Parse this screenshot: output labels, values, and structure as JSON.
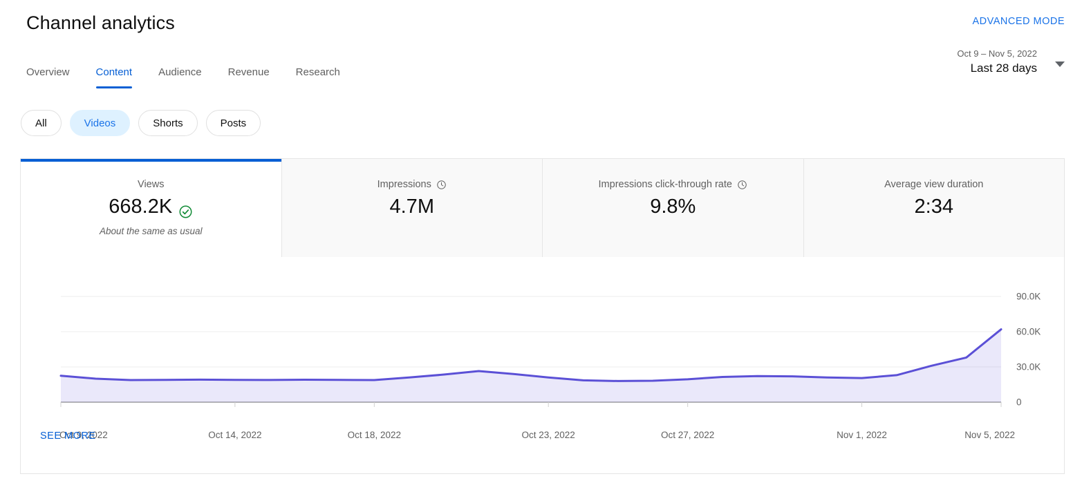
{
  "header": {
    "title": "Channel analytics",
    "advanced_mode_label": "ADVANCED MODE"
  },
  "tabs": [
    {
      "label": "Overview",
      "active": false
    },
    {
      "label": "Content",
      "active": true
    },
    {
      "label": "Audience",
      "active": false
    },
    {
      "label": "Revenue",
      "active": false
    },
    {
      "label": "Research",
      "active": false
    }
  ],
  "date_range": {
    "range_text": "Oct 9 – Nov 5, 2022",
    "preset_label": "Last 28 days",
    "caret_icon": "chevron-down-icon"
  },
  "chips": [
    {
      "label": "All",
      "selected": false
    },
    {
      "label": "Videos",
      "selected": true
    },
    {
      "label": "Shorts",
      "selected": false
    },
    {
      "label": "Posts",
      "selected": false
    }
  ],
  "metrics": [
    {
      "label": "Views",
      "value": "668.2K",
      "note": "About the same as usual",
      "selected": true,
      "has_clock_icon": false,
      "status_icon": "check-circle-icon"
    },
    {
      "label": "Impressions",
      "value": "4.7M",
      "note": "",
      "selected": false,
      "has_clock_icon": true,
      "status_icon": ""
    },
    {
      "label": "Impressions click-through rate",
      "value": "9.8%",
      "note": "",
      "selected": false,
      "has_clock_icon": true,
      "status_icon": ""
    },
    {
      "label": "Average view duration",
      "value": "2:34",
      "note": "",
      "selected": false,
      "has_clock_icon": false,
      "status_icon": ""
    }
  ],
  "footer": {
    "see_more_label": "SEE MORE"
  },
  "colors": {
    "accent_blue": "#065fd4",
    "link_blue": "#1a73e8",
    "line_purple": "#5b50d6",
    "area_fill": "#e9e7f8",
    "chip_selected_bg": "#def1ff",
    "status_green": "#0f8a34"
  },
  "chart_data": {
    "type": "area",
    "title": "",
    "xlabel": "",
    "ylabel": "",
    "ylim": [
      0,
      100000
    ],
    "yticks": [
      0,
      30000,
      60000,
      90000
    ],
    "ytick_labels": [
      "0",
      "30.0K",
      "60.0K",
      "90.0K"
    ],
    "grid": true,
    "legend": "none",
    "x": [
      "Oct 9, 2022",
      "Oct 10, 2022",
      "Oct 11, 2022",
      "Oct 12, 2022",
      "Oct 13, 2022",
      "Oct 14, 2022",
      "Oct 15, 2022",
      "Oct 16, 2022",
      "Oct 17, 2022",
      "Oct 18, 2022",
      "Oct 19, 2022",
      "Oct 20, 2022",
      "Oct 21, 2022",
      "Oct 22, 2022",
      "Oct 23, 2022",
      "Oct 24, 2022",
      "Oct 25, 2022",
      "Oct 26, 2022",
      "Oct 27, 2022",
      "Oct 28, 2022",
      "Oct 29, 2022",
      "Oct 30, 2022",
      "Oct 31, 2022",
      "Nov 1, 2022",
      "Nov 2, 2022",
      "Nov 3, 2022",
      "Nov 4, 2022",
      "Nov 5, 2022"
    ],
    "xtick_labels": [
      "Oct 9, 2022",
      "Oct 14, 2022",
      "Oct 18, 2022",
      "Oct 23, 2022",
      "Oct 27, 2022",
      "Nov 1, 2022",
      "Nov 5, 2022"
    ],
    "xtick_indices": [
      0,
      5,
      9,
      14,
      18,
      23,
      27
    ],
    "series": [
      {
        "name": "Views",
        "color": "#5b50d6",
        "values": [
          22500,
          20000,
          18800,
          19000,
          19200,
          19000,
          18900,
          19100,
          19000,
          18800,
          21000,
          23500,
          26500,
          24000,
          21000,
          18600,
          18000,
          18200,
          19500,
          21500,
          22200,
          22000,
          21000,
          20500,
          23000,
          31000,
          38000,
          62000
        ]
      }
    ]
  }
}
